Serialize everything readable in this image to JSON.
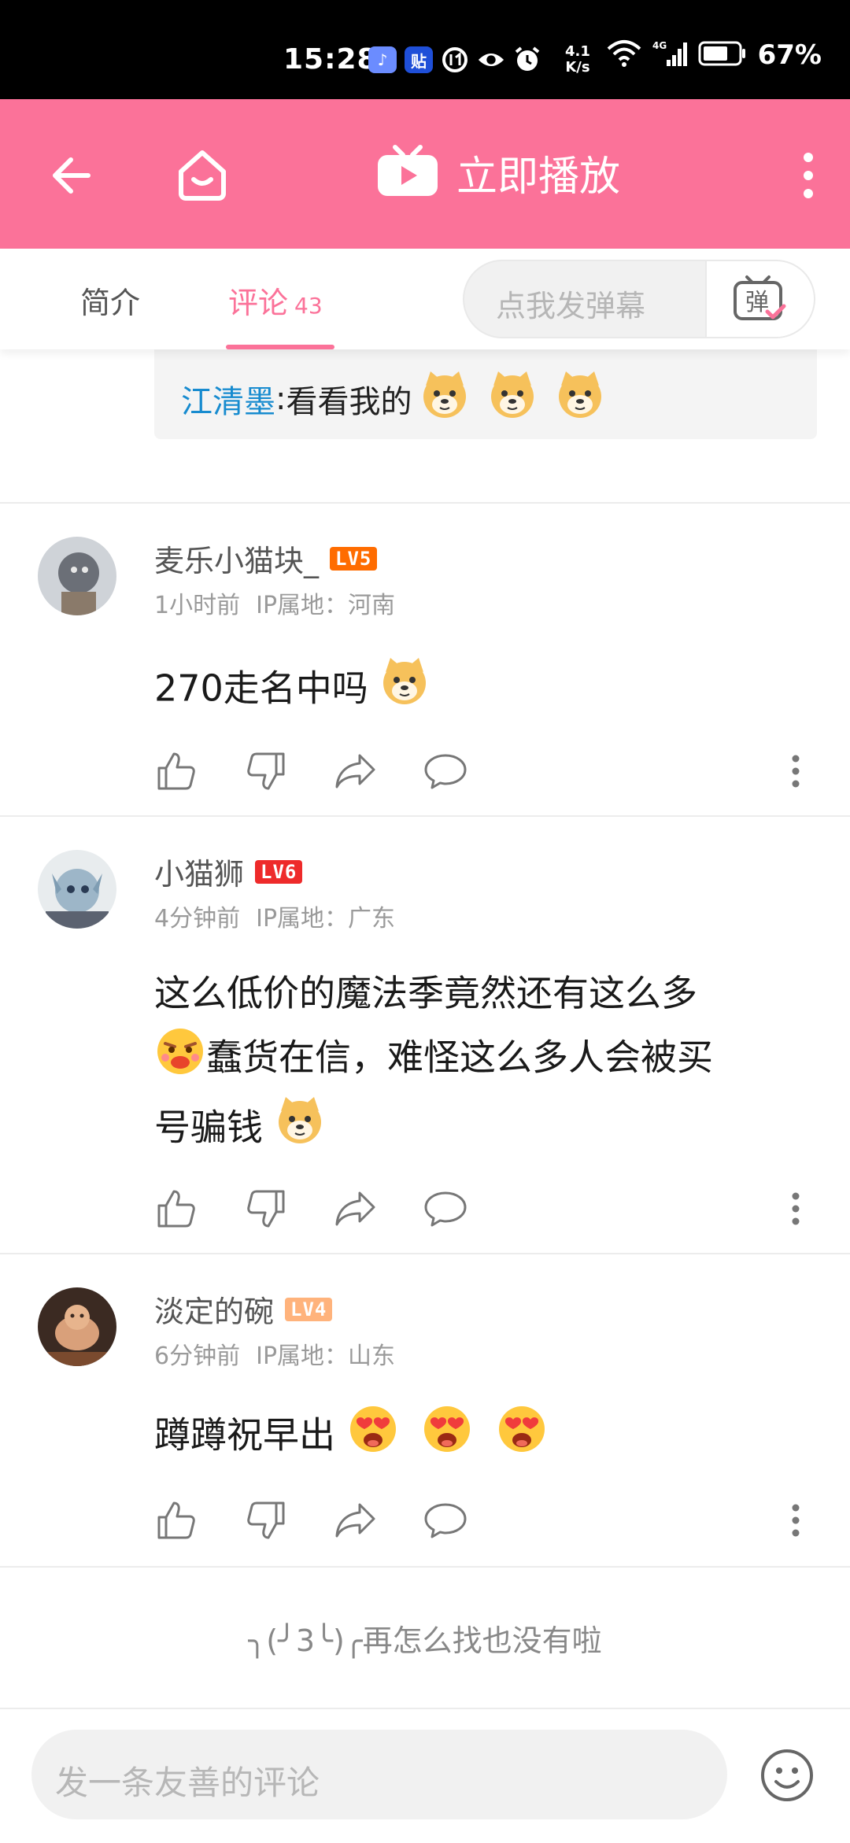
{
  "status_bar": {
    "time": "15:28",
    "net_speed_value": "4.1",
    "net_speed_unit": "K/s",
    "network": "4G",
    "battery": "67%"
  },
  "header": {
    "title": "立即播放",
    "back_icon": "back-arrow-icon",
    "home_icon": "home-icon",
    "tv_icon": "tv-play-icon",
    "more_icon": "more-vertical-icon",
    "bg_color": "#fb7299"
  },
  "tabs": {
    "intro_label": "简介",
    "comments_label": "评论",
    "comments_count": "43",
    "danmaku_placeholder": "点我发弹幕",
    "danmaku_button": "弹"
  },
  "reply_snippet": {
    "author": "江清墨",
    "separator": ":",
    "text": " 看看我的"
  },
  "comments": [
    {
      "username": "麦乐小猫块_",
      "level": "LV5",
      "time": "1小时前",
      "ip": "IP属地：河南",
      "text": "270走名中吗"
    },
    {
      "username": "小猫狮",
      "level": "LV6",
      "time": "4分钟前",
      "ip": "IP属地：广东",
      "line1": "这么低价的魔法季竟然还有这么多",
      "line2": "蠢货在信，难怪这么多人会被买",
      "line3": "号骗钱"
    },
    {
      "username": "淡定的碗",
      "level": "LV4",
      "time": "6分钟前",
      "ip": "IP属地：山东",
      "text": "蹲蹲祝早出"
    }
  ],
  "end_text": "╮(╯3╰)╭再怎么找也没有啦",
  "bottom_bar": {
    "placeholder": "发一条友善的评论",
    "emoji_icon": "smiley-icon"
  }
}
